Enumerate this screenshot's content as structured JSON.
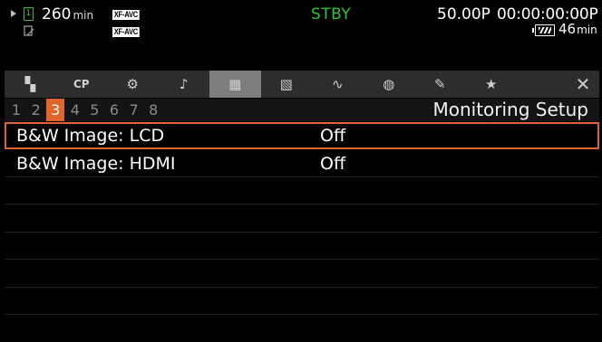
{
  "status": {
    "rec_time_value": "260",
    "rec_time_unit": "min",
    "slot_label": "1",
    "format_badge_1": "XF-AVC",
    "format_badge_2": "XF-AVC",
    "mode": "STBY",
    "frame_rate": "50.00P",
    "timecode": "00:00:00:00",
    "timecode_suffix": "P",
    "battery_time_value": "46",
    "battery_time_unit": "min"
  },
  "tabs": [
    {
      "icon": "camera-icon",
      "glyph": "▚"
    },
    {
      "icon": "custom-picture-icon",
      "glyph": "CP"
    },
    {
      "icon": "camera-setup-icon",
      "glyph": "⚙"
    },
    {
      "icon": "audio-icon",
      "glyph": "♪"
    },
    {
      "icon": "monitoring-icon",
      "glyph": "▦",
      "selected": true
    },
    {
      "icon": "recording-media-icon",
      "glyph": "▧"
    },
    {
      "icon": "waveform-icon",
      "glyph": "∿"
    },
    {
      "icon": "assignable-button-icon",
      "glyph": "◍"
    },
    {
      "icon": "system-setup-icon",
      "glyph": "✎"
    },
    {
      "icon": "my-menu-icon",
      "glyph": "★"
    }
  ],
  "close_glyph": "✕",
  "pages": [
    "1",
    "2",
    "3",
    "4",
    "5",
    "6",
    "7",
    "8"
  ],
  "active_page": "3",
  "menu_title": "Monitoring Setup",
  "items": [
    {
      "name": "B&W Image: LCD",
      "value": "Off",
      "selected": true
    },
    {
      "name": "B&W Image: HDMI",
      "value": "Off",
      "selected": false
    }
  ],
  "colors": {
    "accent": "#e0652a",
    "stby": "#2ec23a",
    "tab_bg": "#2d2d2d",
    "tab_selected": "#7d7d7d"
  }
}
